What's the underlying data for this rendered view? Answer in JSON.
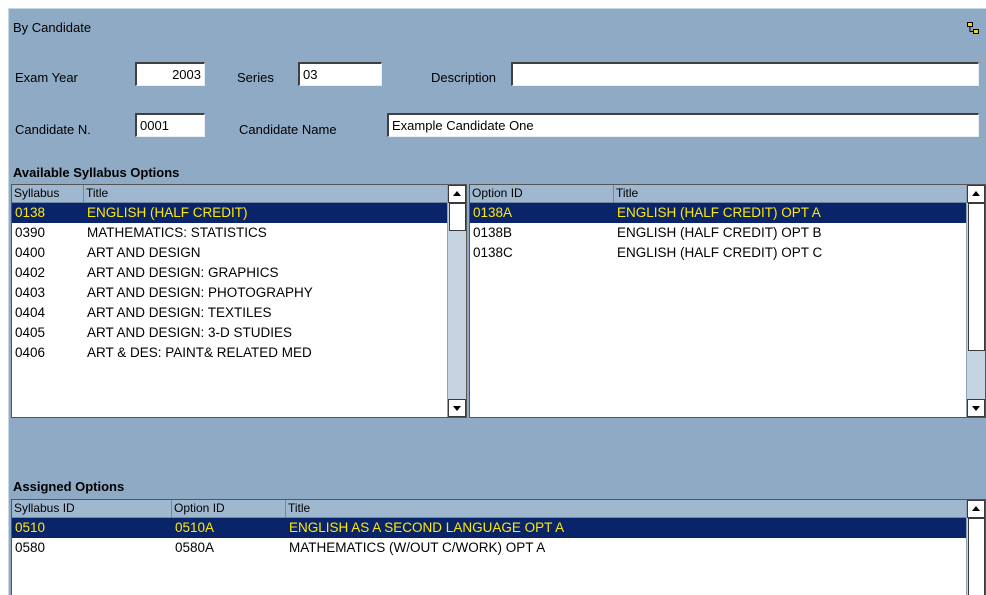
{
  "panel": {
    "title": "By Candidate",
    "exam_year_label": "Exam Year",
    "exam_year_value": "2003",
    "series_label": "Series",
    "series_value": "03",
    "description_label": "Description",
    "description_value": "",
    "candidate_no_label": "Candidate N.",
    "candidate_no_value": "0001",
    "candidate_name_label": "Candidate Name",
    "candidate_name_value": "Example Candidate One"
  },
  "available": {
    "title": "Available Syllabus Options",
    "syllabus_headers": [
      "Syllabus",
      "Title"
    ],
    "syllabus_rows": [
      {
        "code": "0138",
        "title": "ENGLISH (HALF CREDIT)",
        "selected": true
      },
      {
        "code": "0390",
        "title": "MATHEMATICS: STATISTICS",
        "selected": false
      },
      {
        "code": "0400",
        "title": "ART AND DESIGN",
        "selected": false
      },
      {
        "code": "0402",
        "title": "ART AND DESIGN: GRAPHICS",
        "selected": false
      },
      {
        "code": "0403",
        "title": "ART AND DESIGN: PHOTOGRAPHY",
        "selected": false
      },
      {
        "code": "0404",
        "title": "ART AND DESIGN: TEXTILES",
        "selected": false
      },
      {
        "code": "0405",
        "title": "ART AND DESIGN: 3-D STUDIES",
        "selected": false
      },
      {
        "code": "0406",
        "title": "ART & DES: PAINT& RELATED MED",
        "selected": false
      }
    ],
    "option_headers": [
      "Option ID",
      "Title"
    ],
    "option_rows": [
      {
        "id": "0138A",
        "title": "ENGLISH (HALF CREDIT) OPT A",
        "selected": true
      },
      {
        "id": "0138B",
        "title": "ENGLISH (HALF CREDIT) OPT B",
        "selected": false
      },
      {
        "id": "0138C",
        "title": "ENGLISH (HALF CREDIT) OPT C",
        "selected": false
      }
    ]
  },
  "assigned": {
    "title": "Assigned Options",
    "headers": [
      "Syllabus ID",
      "Option ID",
      "Title"
    ],
    "rows": [
      {
        "syllabus": "0510",
        "option": "0510A",
        "title": "ENGLISH AS A SECOND LANGUAGE OPT A",
        "selected": true
      },
      {
        "syllabus": "0580",
        "option": "0580A",
        "title": "MATHEMATICS (W/OUT C/WORK) OPT A",
        "selected": false
      }
    ]
  },
  "colors": {
    "panel": "#8eaac4",
    "selection_bg": "#0a246a",
    "selection_fg": "#ffea00"
  },
  "icons": {
    "restore": "restore-icon",
    "scroll_up": "arrow-up-icon",
    "scroll_down": "arrow-down-icon"
  }
}
